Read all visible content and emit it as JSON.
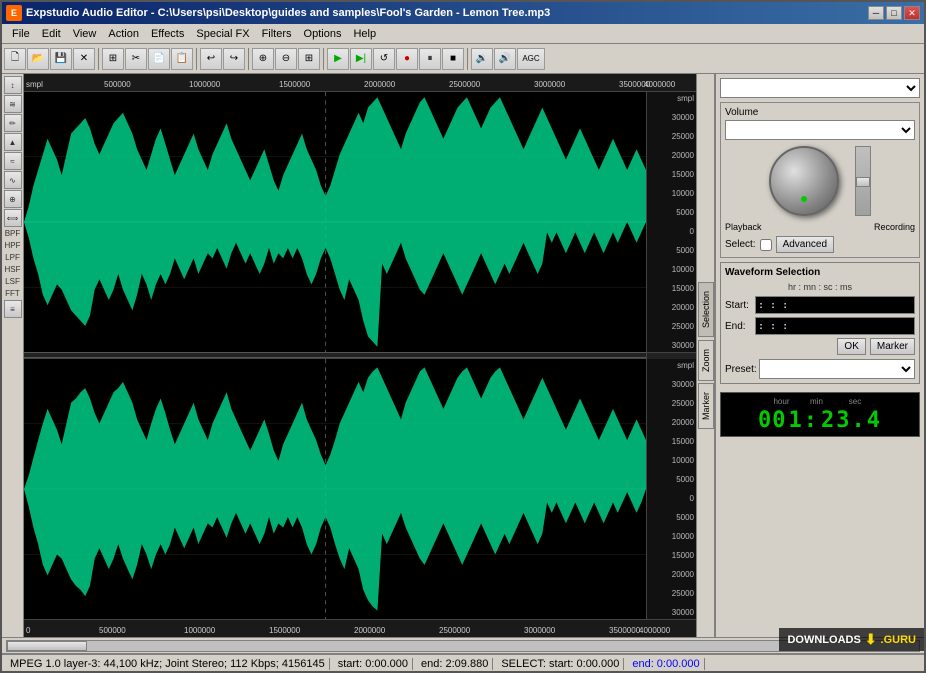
{
  "titleBar": {
    "title": "Expstudio Audio Editor - C:\\Users\\psi\\Desktop\\guides and samples\\Fool's Garden - Lemon Tree.mp3",
    "icon": "E"
  },
  "menuBar": {
    "items": [
      "File",
      "Edit",
      "View",
      "Action",
      "Effects",
      "Special FX",
      "Filters",
      "Options",
      "Help"
    ]
  },
  "toolbar": {
    "buttons": [
      {
        "name": "new",
        "icon": "📄"
      },
      {
        "name": "open",
        "icon": "📂"
      },
      {
        "name": "save",
        "icon": "💾"
      },
      {
        "name": "cut-file",
        "icon": "✂"
      },
      {
        "name": "copy-to-new",
        "icon": "⊞"
      },
      {
        "name": "cut",
        "icon": "✂"
      },
      {
        "name": "copy",
        "icon": "📋"
      },
      {
        "name": "paste",
        "icon": "📋"
      },
      {
        "name": "undo",
        "icon": "↩"
      },
      {
        "name": "redo",
        "icon": "↪"
      },
      {
        "name": "zoom-in",
        "icon": "🔍"
      },
      {
        "name": "zoom-out",
        "icon": "🔎"
      },
      {
        "name": "zoom-all",
        "icon": "⊞"
      },
      {
        "name": "play",
        "icon": "▶"
      },
      {
        "name": "play-sel",
        "icon": "▶"
      },
      {
        "name": "loop",
        "icon": "↺"
      },
      {
        "name": "record",
        "icon": "⏺"
      },
      {
        "name": "pause",
        "icon": "⏸"
      },
      {
        "name": "stop",
        "icon": "⏹"
      },
      {
        "name": "vol-down",
        "icon": "🔉"
      },
      {
        "name": "vol-up",
        "icon": "🔊"
      },
      {
        "name": "agc",
        "label": "AGC"
      }
    ]
  },
  "leftToolbar": {
    "items": [
      {
        "label": "↕",
        "name": "select-tool"
      },
      {
        "label": "≋",
        "name": "wave-tool"
      },
      {
        "label": "⌇",
        "name": "pencil-tool"
      },
      {
        "label": "▲",
        "name": "peak-tool"
      },
      {
        "label": "≈",
        "name": "smooth-tool"
      },
      {
        "label": "∿",
        "name": "freq-tool"
      },
      {
        "label": "⊞",
        "name": "zoom-tool"
      },
      {
        "label": "⟺",
        "name": "pan-tool"
      },
      {
        "label": "BPF",
        "name": "bpf-label"
      },
      {
        "label": "HPF",
        "name": "hpf-label"
      },
      {
        "label": "LPF",
        "name": "lpf-label"
      },
      {
        "label": "HSF",
        "name": "hsf-label"
      },
      {
        "label": "LSF",
        "name": "lsf-label"
      },
      {
        "label": "FFT",
        "name": "fft-label"
      },
      {
        "label": "≡",
        "name": "list-tool"
      }
    ]
  },
  "rightPanel": {
    "deviceSelect": "",
    "volumeLabel": "Volume",
    "advancedButton": "Advanced",
    "selectLabel": "Select:",
    "waveformSelection": {
      "title": "Waveform Selection",
      "timeFormat": "hr : mn : sc : ms",
      "startLabel": "Start:",
      "startValue": ": : :",
      "endLabel": "End:",
      "endValue": ": : :",
      "okButton": "OK",
      "markerButton": "Marker",
      "presetLabel": "Preset:",
      "presetValue": ""
    },
    "sideTabs": [
      "Selection",
      "Zoom",
      "Marker"
    ],
    "timeDisplay": {
      "hourLabel": "hour",
      "minLabel": "min",
      "secLabel": "sec",
      "hourValue": "00",
      "minValue": "1:",
      "secValue": "23.4"
    }
  },
  "statusBar": {
    "fileInfo": "MPEG 1.0 layer-3: 44,100 kHz; Joint Stereo; 112 Kbps; 4156145",
    "startTime": "start: 0:00.000",
    "endTime": "end: 2:09.880",
    "selectInfo": "SELECT: start: 0:00.000",
    "selectEnd": "end: 0:00.000"
  },
  "waveform": {
    "channels": 2,
    "scaleValues": [
      "smpl",
      "30000",
      "25000",
      "20000",
      "15000",
      "10000",
      "5000",
      "0",
      "5000",
      "10000",
      "15000",
      "20000",
      "25000",
      "30000"
    ],
    "timelineMarkers": [
      "0",
      "500000",
      "1000000",
      "1500000",
      "2000000",
      "2500000",
      "3000000",
      "3500000",
      "4000000"
    ]
  },
  "watermark": {
    "text": "DOWNLOADS",
    "suffix": ".GURU",
    "arrow": "⬇"
  }
}
